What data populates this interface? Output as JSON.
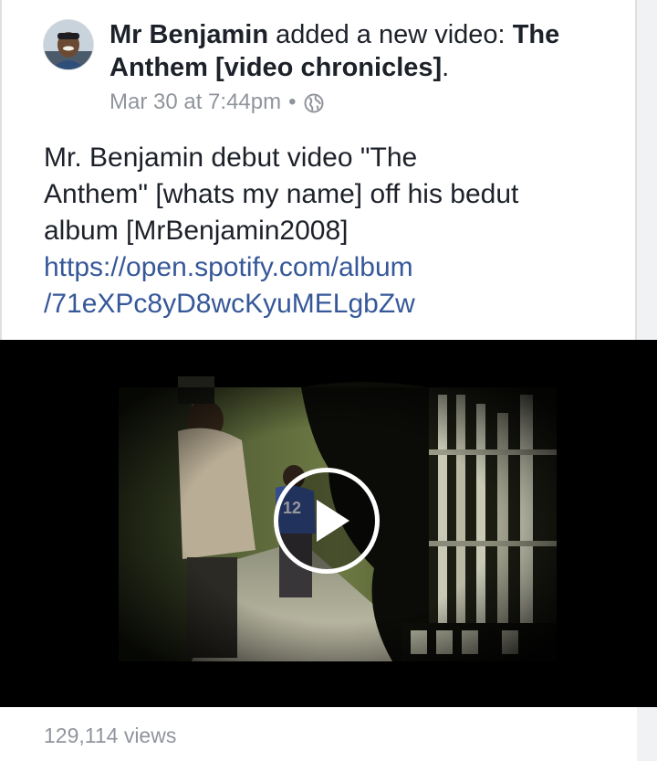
{
  "post": {
    "author": "Mr Benjamin",
    "action": " added a new video: ",
    "video_title": "The Anthem [video chronicles]",
    "period": ".",
    "timestamp": "Mar 30 at 7:44pm",
    "separator": "•",
    "privacy_icon": "globe-icon",
    "body_lines": [
      "Mr. Benjamin debut video \"The",
      "Anthem\" [whats my name] off his bedut",
      "album [MrBenjamin2008]"
    ],
    "link_lines": [
      "https://open.spotify.com/album",
      "/71eXPc8yD8wcKyuMELgbZw"
    ]
  },
  "video": {
    "play_icon": "play-icon",
    "jersey_text": "12",
    "views": "129,114 views"
  },
  "colors": {
    "text": "#1d2129",
    "meta": "#90949c",
    "link": "#365899",
    "video_bg": "#000000"
  }
}
